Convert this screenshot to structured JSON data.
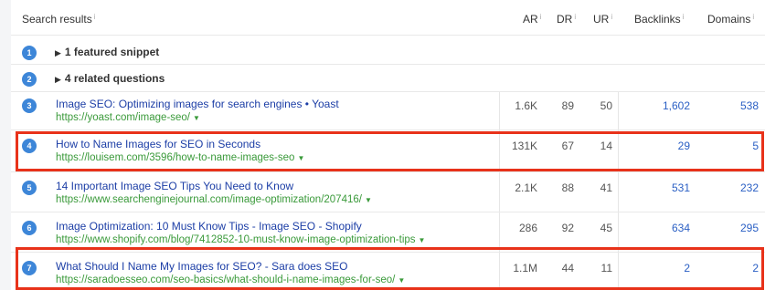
{
  "header": {
    "search_results": "Search results",
    "ar": "AR",
    "dr": "DR",
    "ur": "UR",
    "backlinks": "Backlinks",
    "domains": "Domains",
    "info_glyph": "i"
  },
  "serp_features": [
    {
      "num": "1",
      "label": "1 featured snippet"
    },
    {
      "num": "2",
      "label": "4 related questions"
    }
  ],
  "results": [
    {
      "num": "3",
      "title": "Image SEO: Optimizing images for search engines • Yoast",
      "url": "https://yoast.com/image-seo/",
      "ar": "1.6K",
      "dr": "89",
      "ur": "50",
      "backlinks": "1,602",
      "domains": "538",
      "highlighted": false
    },
    {
      "num": "4",
      "title": "How to Name Images for SEO in Seconds",
      "url": "https://louisem.com/3596/how-to-name-images-seo",
      "ar": "131K",
      "dr": "67",
      "ur": "14",
      "backlinks": "29",
      "domains": "5",
      "highlighted": true
    },
    {
      "num": "5",
      "title": "14 Important Image SEO Tips You Need to Know",
      "url": "https://www.searchenginejournal.com/image-optimization/207416/",
      "ar": "2.1K",
      "dr": "88",
      "ur": "41",
      "backlinks": "531",
      "domains": "232",
      "highlighted": false
    },
    {
      "num": "6",
      "title": "Image Optimization: 10 Must Know Tips - Image SEO - Shopify",
      "url": "https://www.shopify.com/blog/7412852-10-must-know-image-optimization-tips",
      "ar": "286",
      "dr": "92",
      "ur": "45",
      "backlinks": "634",
      "domains": "295",
      "highlighted": false
    },
    {
      "num": "7",
      "title": "What Should I Name My Images for SEO? - Sara does SEO",
      "url": "https://saradoesseo.com/seo-basics/what-should-i-name-images-for-seo/",
      "ar": "1.1M",
      "dr": "44",
      "ur": "11",
      "backlinks": "2",
      "domains": "2",
      "highlighted": true
    }
  ],
  "colors": {
    "highlight_border": "#e8321a",
    "number_badge": "#3d86d8",
    "title_link": "#1c3ea6",
    "url_green": "#3a9a3a",
    "metric_link": "#2a5fc4"
  },
  "icons": {
    "expand": "triangle-right-icon",
    "url_menu": "caret-down-icon",
    "info": "info-icon"
  }
}
